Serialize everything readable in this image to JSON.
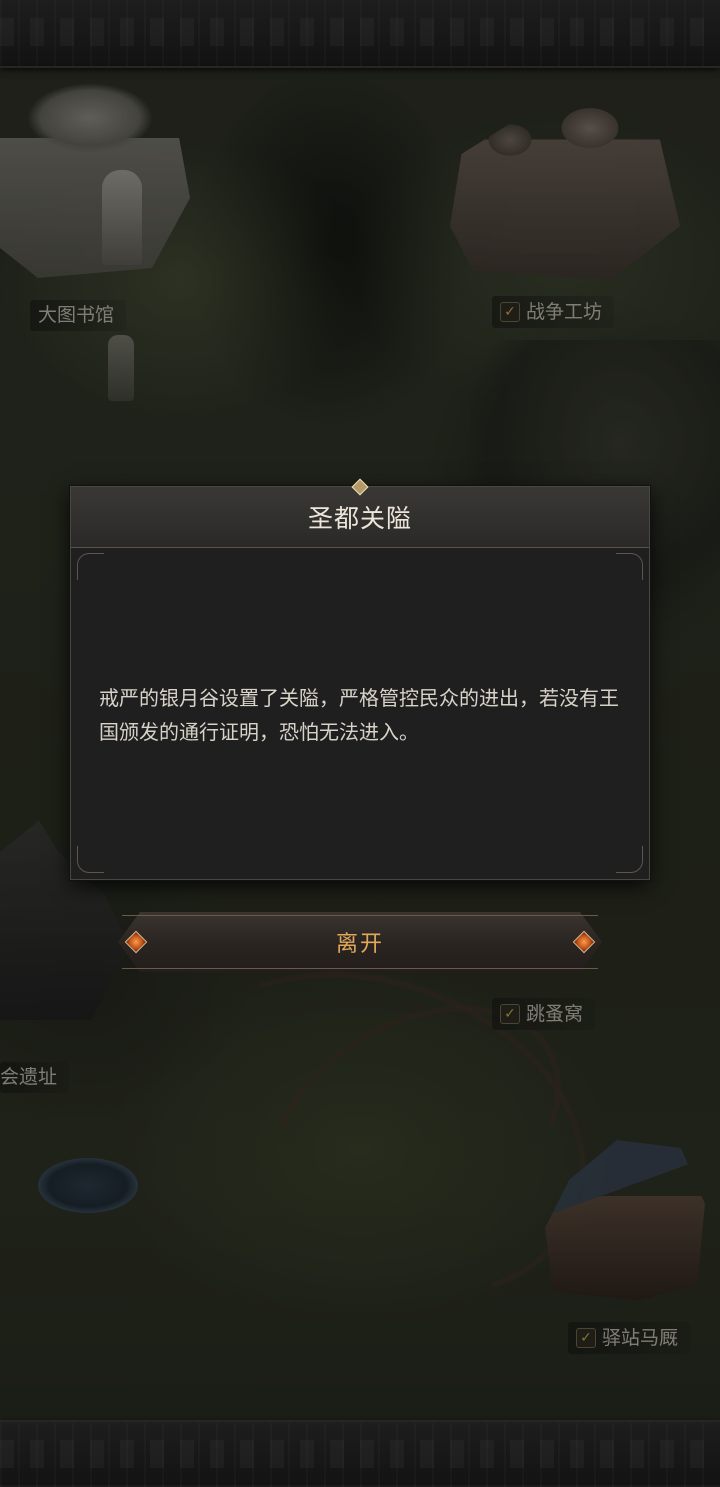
{
  "map": {
    "locations": [
      {
        "label": "大图书馆",
        "checked": false
      },
      {
        "label": "战争工坊",
        "checked": true
      },
      {
        "label": "跳蚤窝",
        "checked": true
      },
      {
        "label": "会遗址",
        "checked": false
      },
      {
        "label": "驿站马厩",
        "checked": true
      }
    ],
    "check_icon": "checkmark-icon"
  },
  "dialog": {
    "title": "圣都关隘",
    "body": "戒严的银月谷设置了关隘，严格管控民众的进出，若没有王国颁发的通行证明，恐怕无法进入。",
    "leave_label": "离开"
  },
  "colors": {
    "accent_gold": "#e2a85c",
    "check_gold": "#c9a24a",
    "gem_orange": "#c2561c",
    "panel_bg": "#1f1f20"
  }
}
